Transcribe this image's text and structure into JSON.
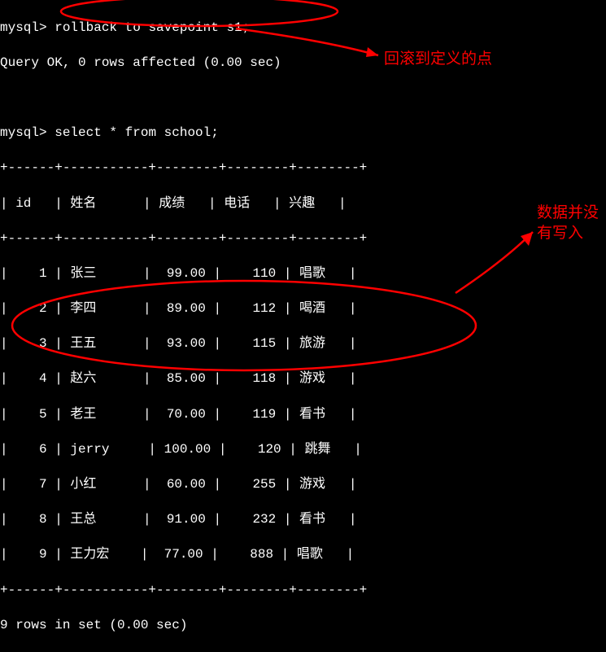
{
  "prompt": "mysql>",
  "cmd1": "rollback to savepoint s1;",
  "result1": "Query OK, 0 rows affected (0.00 sec)",
  "cmd2": "select * from school;",
  "border": "+------+-----------+--------+--------+--------+",
  "header": "| id   | 姓名      | 成绩   | 电话   | 兴趣   |",
  "rows": [
    "|    1 | 张三      |  99.00 |    110 | 唱歌   |",
    "|    2 | 李四      |  89.00 |    112 | 喝酒   |",
    "|    3 | 王五      |  93.00 |    115 | 旅游   |",
    "|    4 | 赵六      |  85.00 |    118 | 游戏   |",
    "|    5 | 老王      |  70.00 |    119 | 看书   |",
    "|    6 | jerry     | 100.00 |    120 | 跳舞   |",
    "|    7 | 小红      |  60.00 |    255 | 游戏   |",
    "|    8 | 王总      |  91.00 |    232 | 看书   |",
    "|    9 | 王力宏    |  77.00 |    888 | 唱歌   |"
  ],
  "footer": "9 rows in set (0.00 sec)",
  "annotation1": "回滚到定义的点",
  "annotation2": "数据并没有写入",
  "chart_data": {
    "type": "table",
    "title": "school",
    "columns": [
      "id",
      "姓名",
      "成绩",
      "电话",
      "兴趣"
    ],
    "rows": [
      {
        "id": 1,
        "姓名": "张三",
        "成绩": 99.0,
        "电话": 110,
        "兴趣": "唱歌"
      },
      {
        "id": 2,
        "姓名": "李四",
        "成绩": 89.0,
        "电话": 112,
        "兴趣": "喝酒"
      },
      {
        "id": 3,
        "姓名": "王五",
        "成绩": 93.0,
        "电话": 115,
        "兴趣": "旅游"
      },
      {
        "id": 4,
        "姓名": "赵六",
        "成绩": 85.0,
        "电话": 118,
        "兴趣": "游戏"
      },
      {
        "id": 5,
        "姓名": "老王",
        "成绩": 70.0,
        "电话": 119,
        "兴趣": "看书"
      },
      {
        "id": 6,
        "姓名": "jerry",
        "成绩": 100.0,
        "电话": 120,
        "兴趣": "跳舞"
      },
      {
        "id": 7,
        "姓名": "小红",
        "成绩": 60.0,
        "电话": 255,
        "兴趣": "游戏"
      },
      {
        "id": 8,
        "姓名": "王总",
        "成绩": 91.0,
        "电话": 232,
        "兴趣": "看书"
      },
      {
        "id": 9,
        "姓名": "王力宏",
        "成绩": 77.0,
        "电话": 888,
        "兴趣": "唱歌"
      }
    ]
  }
}
